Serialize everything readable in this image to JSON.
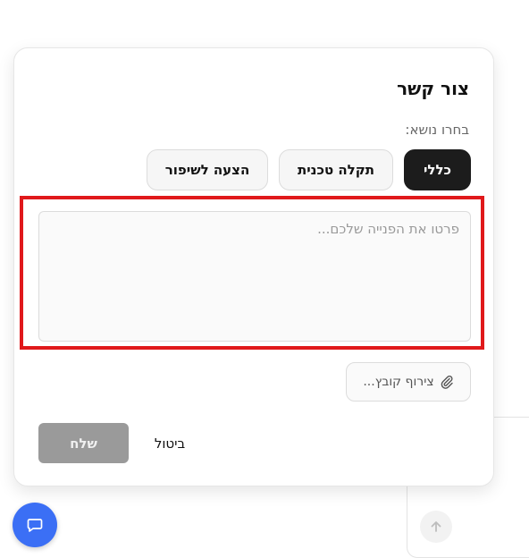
{
  "dialog": {
    "title": "צור קשר",
    "subtitle": "בחרו נושא:",
    "topics": [
      {
        "label": "כללי",
        "selected": true
      },
      {
        "label": "תקלה טכנית",
        "selected": false
      },
      {
        "label": "הצעה לשיפור",
        "selected": false
      }
    ],
    "message_placeholder": "פרטו את הפנייה שלכם...",
    "message_value": "",
    "attach_label": "צירוף קובץ...",
    "send_label": "שלח",
    "cancel_label": "ביטול"
  },
  "colors": {
    "accent": "#1c1c1c",
    "highlight": "#e0191b",
    "chat_button": "#3b6ff5",
    "send_disabled": "#9a9a9a"
  },
  "icons": {
    "attach": "paperclip-icon",
    "chat": "chat-bubble-icon",
    "scroll": "arrow-up-icon"
  }
}
